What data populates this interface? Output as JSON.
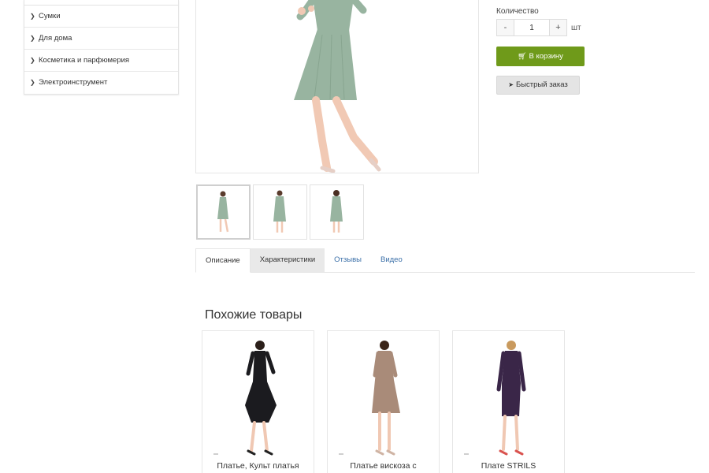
{
  "sidebar": {
    "items": [
      {
        "label": "Сумки"
      },
      {
        "label": "Для дома"
      },
      {
        "label": "Косметика и парфюмерия"
      },
      {
        "label": "Электроинструмент"
      }
    ]
  },
  "purchase": {
    "quantity_label": "Количество",
    "minus": "-",
    "plus": "+",
    "quantity_value": "1",
    "unit": "шт",
    "cart_label": "В корзину",
    "quick_label": "Быстрый заказ"
  },
  "tabs": [
    {
      "label": "Описание"
    },
    {
      "label": "Характеристики"
    },
    {
      "label": "Отзывы"
    },
    {
      "label": "Видео"
    }
  ],
  "similar": {
    "title": "Похожие товары",
    "items": [
      {
        "title": "Платье, Культ платья",
        "color": "#1b1b1f"
      },
      {
        "title": "Платье вискоза с",
        "color": "#a98b79"
      },
      {
        "title": "Плате STRILS",
        "color": "#3a2648"
      }
    ]
  },
  "colors": {
    "dress_main": "#98b4a0",
    "accent_green": "#6f9a1a",
    "link_blue": "#3a6fa8"
  }
}
